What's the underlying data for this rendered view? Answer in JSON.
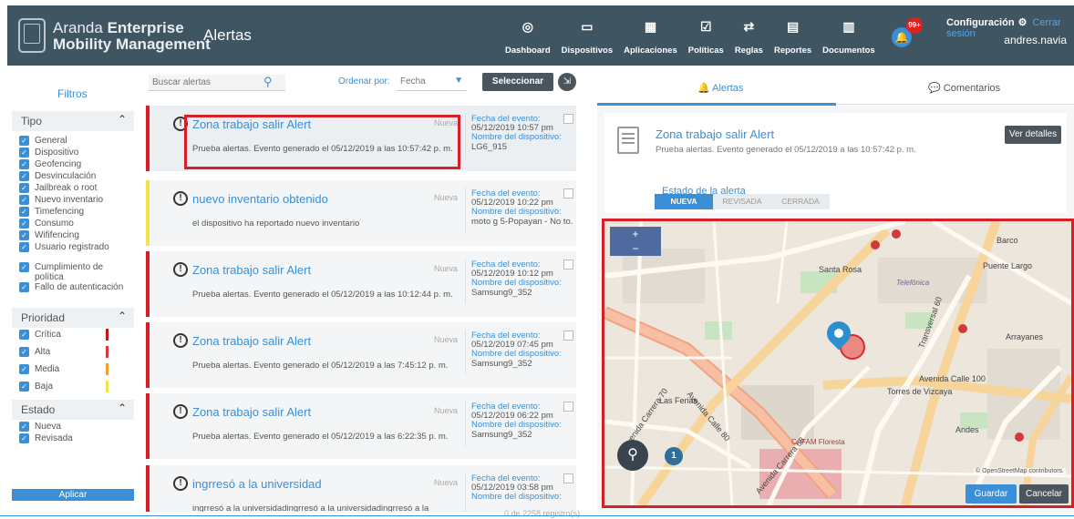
{
  "header": {
    "brand_prefix": "Aranda",
    "brand_bold": "Enterprise",
    "brand_line2": "Mobility Management",
    "page_title": "Alertas",
    "nav": [
      {
        "label": "Dashboard",
        "icon": "dashboard-icon",
        "glyph": "◎"
      },
      {
        "label": "Dispositivos",
        "icon": "devices-icon",
        "glyph": "▭"
      },
      {
        "label": "Aplicaciones",
        "icon": "apps-grid-icon",
        "glyph": "▦"
      },
      {
        "label": "Políticas",
        "icon": "policies-icon",
        "glyph": "☑"
      },
      {
        "label": "Reglas",
        "icon": "rules-icon",
        "glyph": "⇄"
      },
      {
        "label": "Reportes",
        "icon": "reports-icon",
        "glyph": "▤"
      },
      {
        "label": "Documentos",
        "icon": "documents-icon",
        "glyph": "▥"
      }
    ],
    "notifications_badge": "99+",
    "config_label": "Configuración",
    "logout_label": "Cerrar sesión",
    "username": "andres.navia"
  },
  "sidebar": {
    "title": "Filtros",
    "tipo": {
      "label": "Tipo",
      "items": [
        "General",
        "Dispositivo",
        "Geofencing",
        "Desvinculación",
        "Jailbreak o root",
        "Nuevo inventario",
        "Timefencing",
        "Consumo",
        "Wififencing",
        "Usuario registrado",
        "Cumplimiento de política",
        "Fallo de autenticación"
      ]
    },
    "prioridad": {
      "label": "Prioridad",
      "items": [
        {
          "label": "Crítica",
          "color": "#c0171d"
        },
        {
          "label": "Alta",
          "color": "#d9363e"
        },
        {
          "label": "Media",
          "color": "#f0a030"
        },
        {
          "label": "Baja",
          "color": "#f5e34a"
        }
      ]
    },
    "estado": {
      "label": "Estado",
      "items": [
        "Nueva",
        "Revisada"
      ]
    },
    "apply_label": "Aplicar"
  },
  "toolbar": {
    "search_placeholder": "Buscar alertas",
    "sort_label": "Ordenar por:",
    "sort_value": "Fecha",
    "select_all_label": "Seleccionar todos"
  },
  "alerts": [
    {
      "title": "Zona trabajo salir Alert",
      "desc": "Prueba alertas. Evento generado el 05/12/2019 a las 10:57:42 p. m.",
      "status": "Nueva",
      "date_label": "Fecha del evento:",
      "date": "05/12/2019 10:57 pm",
      "device_label": "Nombre del dispositivo:",
      "device": "LG6_915",
      "priority_color": "#d61f26"
    },
    {
      "title": "nuevo inventario obtenido",
      "desc": "el dispositivo ha reportado nuevo inventario",
      "status": "Nueva",
      "date_label": "Fecha del evento:",
      "date": "05/12/2019 10:22 pm",
      "device_label": "Nombre del dispositivo:",
      "device": "moto g 5-Popayan - No to...",
      "priority_color": "#f5e34a"
    },
    {
      "title": "Zona trabajo salir Alert",
      "desc": "Prueba alertas. Evento generado el 05/12/2019 a las 10:12:44 p. m.",
      "status": "Nueva",
      "date_label": "Fecha del evento:",
      "date": "05/12/2019 10:12 pm",
      "device_label": "Nombre del dispositivo:",
      "device": "Samsung9_352",
      "priority_color": "#d61f26"
    },
    {
      "title": "Zona trabajo salir Alert",
      "desc": "Prueba alertas. Evento generado el 05/12/2019 a las 7:45:12 p. m.",
      "status": "Nueva",
      "date_label": "Fecha del evento:",
      "date": "05/12/2019 07:45 pm",
      "device_label": "Nombre del dispositivo:",
      "device": "Samsung9_352",
      "priority_color": "#d61f26"
    },
    {
      "title": "Zona trabajo salir Alert",
      "desc": "Prueba alertas. Evento generado el 05/12/2019 a las 6:22:35 p. m.",
      "status": "Nueva",
      "date_label": "Fecha del evento:",
      "date": "05/12/2019 06:22 pm",
      "device_label": "Nombre del dispositivo:",
      "device": "Samsung9_352",
      "priority_color": "#d61f26"
    },
    {
      "title": "ingrresó a la universidad",
      "desc": "ingrresó a la universidadingrresó a la universidadingrresó a la",
      "status": "Nueva",
      "date_label": "Fecha del evento:",
      "date": "05/12/2019 03:58 pm",
      "device_label": "Nombre del dispositivo:",
      "device": "",
      "priority_color": "#d61f26"
    }
  ],
  "footer_count": "0 de 2258 registro(s)",
  "detail": {
    "tab_alerts": "Alertas",
    "tab_comments": "Comentarios",
    "title": "Zona trabajo salir Alert",
    "desc": "Prueba alertas. Evento generado el 05/12/2019 a las 10:57:42 p. m.",
    "details_label": "Ver detalles",
    "state_label": "Estado de la alerta",
    "states": [
      "NUEVA",
      "REVISADA",
      "CERRADA"
    ],
    "active_state": "NUEVA"
  },
  "map": {
    "streets": [
      "Avenida Calle 80",
      "Avenida Carrera 70",
      "Avenida Calle 100",
      "Transversal 60",
      "Avenida Carrera 68",
      "Santa Rosa",
      "Puente Largo",
      "Barco",
      "Arrayanes",
      "Torres de Vizcaya",
      "Andes",
      "Las Ferias",
      "CAFAM Floresta",
      "Telefónica"
    ],
    "osm_credit": "© OpenStreetMap contributors.",
    "cluster_count": "1",
    "zoom_in": "+",
    "zoom_out": "−",
    "save_label": "Guardar",
    "cancel_label": "Cancelar"
  }
}
